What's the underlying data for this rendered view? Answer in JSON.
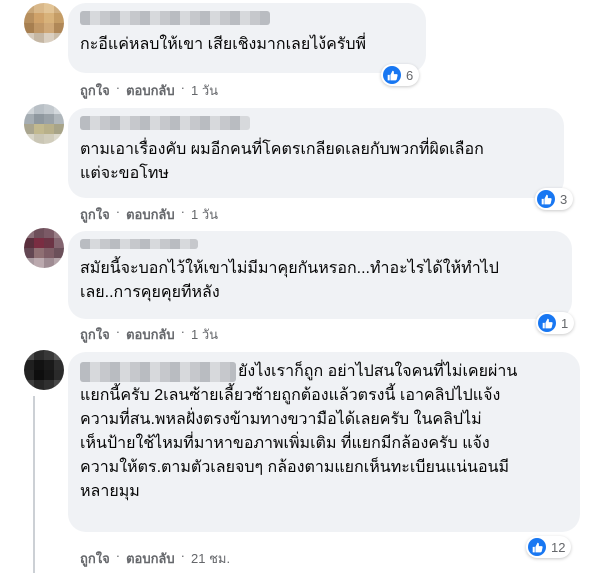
{
  "comments": [
    {
      "text": "กะอีแค่หลบให้เขา เสียเชิงมากเลยไง้ครับพี่",
      "like_label": "ถูกใจ",
      "reply_label": "ตอบกลับ",
      "time": "1 วัน",
      "reactions": "6"
    },
    {
      "text": "ตามเอาเรื่องคับ ผมอีกคนที่โคตรเกลียดเลยกับพวกที่ผิดเลือก\nแต่จะขอโทษ",
      "like_label": "ถูกใจ",
      "reply_label": "ตอบกลับ",
      "time": "1 วัน",
      "reactions": "3"
    },
    {
      "text": "สมัยนี้จะบอกไว้ให้เขาไม่มีมาคุยกันหรอก...ทำอะไรได้ให้ทำไป\nเลย..การคุยคุยทีหลัง",
      "like_label": "ถูกใจ",
      "reply_label": "ตอบกลับ",
      "time": "1 วัน",
      "reactions": "1"
    },
    {
      "text_first": "ยังไงเราก็ถูก อย่าไปสนใจคนที่ไม่เคยผ่าน",
      "text": "แยกนี้ครับ 2เลนซ้ายเลี้ยวซ้ายถูกต้องแล้วตรงนี้ เอาคลิปไปแจ้ง\nความที่สน.พหลฝั่งตรงข้ามทางขวามือได้เลยครับ ในคลิปไม่\nเห็นป้ายใช้ไหมที่มาหาขอภาพเพิ่มเติม ที่แยกมีกล้องครับ แจ้ง\nความให้ตร.ตามตัวเลยจบๆ กล้องตามแยกเห็นทะเบียนแน่นอนมี\nหลายมุม",
      "like_label": "ถูกใจ",
      "reply_label": "ตอบกลับ",
      "time": "21 ชม.",
      "reactions": "12"
    }
  ],
  "colors": {
    "bubble": "#f0f2f5",
    "meta": "#65676b",
    "like_blue": "#1877f2"
  },
  "icons": {
    "reaction": "thumbs-up-icon"
  }
}
